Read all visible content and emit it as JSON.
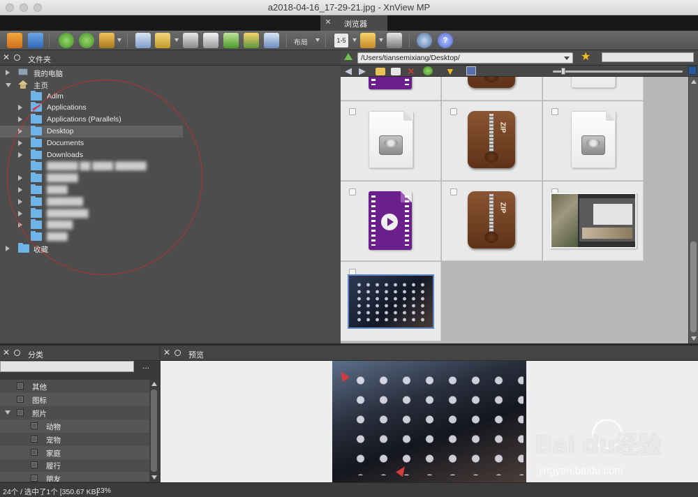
{
  "window": {
    "title": "a2018-04-16_17-29-21.jpg - XnView MP"
  },
  "tabs": [
    {
      "label": "浏览器",
      "active": true
    }
  ],
  "toolbar": {
    "layout_label": "布局",
    "page_range_label": "1-5"
  },
  "folder_panel": {
    "title": "文件夹",
    "rows": [
      {
        "label": "我的电脑",
        "expand": "right",
        "icon": "computer-icon",
        "blurred": false
      },
      {
        "label": "主页",
        "expand": "down",
        "icon": "home-icon",
        "blurred": false
      },
      {
        "label": "Adlm",
        "expand": "",
        "icon": "folder-icon",
        "blurred": false
      },
      {
        "label": "Applications",
        "expand": "right",
        "icon": "restricted-folder-icon",
        "blurred": false
      },
      {
        "label": "Applications (Parallels)",
        "expand": "right",
        "icon": "folder-icon",
        "blurred": false
      },
      {
        "label": "Desktop",
        "expand": "right",
        "icon": "folder-icon",
        "blurred": false,
        "selected": true
      },
      {
        "label": "Documents",
        "expand": "right",
        "icon": "folder-icon",
        "blurred": false
      },
      {
        "label": "Downloads",
        "expand": "right",
        "icon": "folder-icon",
        "blurred": false
      },
      {
        "label": "██████ ██ ████ ██████",
        "expand": "",
        "icon": "folder-icon",
        "blurred": true
      },
      {
        "label": "██████",
        "expand": "right",
        "icon": "folder-icon",
        "blurred": true
      },
      {
        "label": "████",
        "expand": "right",
        "icon": "folder-icon",
        "blurred": true
      },
      {
        "label": "███████",
        "expand": "right",
        "icon": "folder-icon",
        "blurred": true
      },
      {
        "label": "████████",
        "expand": "right",
        "icon": "folder-icon",
        "blurred": true
      },
      {
        "label": "█████",
        "expand": "right",
        "icon": "folder-icon",
        "blurred": true
      },
      {
        "label": "████",
        "expand": "",
        "icon": "folder-icon",
        "blurred": true
      },
      {
        "label": "收藏",
        "expand": "right",
        "icon": "folder-icon",
        "blurred": false
      }
    ]
  },
  "browser": {
    "path": "/Users/tiansemixiang/Desktop/",
    "thumbnails": [
      {
        "kind": "video",
        "checked": false
      },
      {
        "kind": "zip",
        "checked": false
      },
      {
        "kind": "disk",
        "checked": false
      },
      {
        "kind": "disk",
        "checked": false
      },
      {
        "kind": "zip",
        "checked": false
      },
      {
        "kind": "disk",
        "checked": false
      },
      {
        "kind": "video",
        "checked": false
      },
      {
        "kind": "zip",
        "checked": false
      },
      {
        "kind": "screenshot",
        "checked": false
      },
      {
        "kind": "launchpad-screenshot",
        "checked": false,
        "selected": true
      }
    ],
    "zip_badge": "ZIP"
  },
  "category_panel": {
    "title": "分类",
    "more_label": "...",
    "items": [
      {
        "label": "其他",
        "level": 0,
        "expand": ""
      },
      {
        "label": "图标",
        "level": 0,
        "expand": ""
      },
      {
        "label": "照片",
        "level": 0,
        "expand": "down"
      },
      {
        "label": "动物",
        "level": 1,
        "expand": ""
      },
      {
        "label": "宠物",
        "level": 1,
        "expand": ""
      },
      {
        "label": "家庭",
        "level": 1,
        "expand": ""
      },
      {
        "label": "履行",
        "level": 1,
        "expand": ""
      },
      {
        "label": "朋友",
        "level": 1,
        "expand": ""
      }
    ]
  },
  "preview_panel": {
    "title": "预览"
  },
  "status": {
    "count": "24个 / 选中了1个 [350.67 KB]",
    "zoom": "23%"
  },
  "watermark": {
    "brand": "Bai  du经验",
    "url": "jingyan.baidu.com"
  },
  "colors": {
    "accent_selection": "#5d86c8",
    "folder": "#6fb4e8",
    "star": "#f3c21a",
    "annotation_circle": "#dc2828"
  }
}
